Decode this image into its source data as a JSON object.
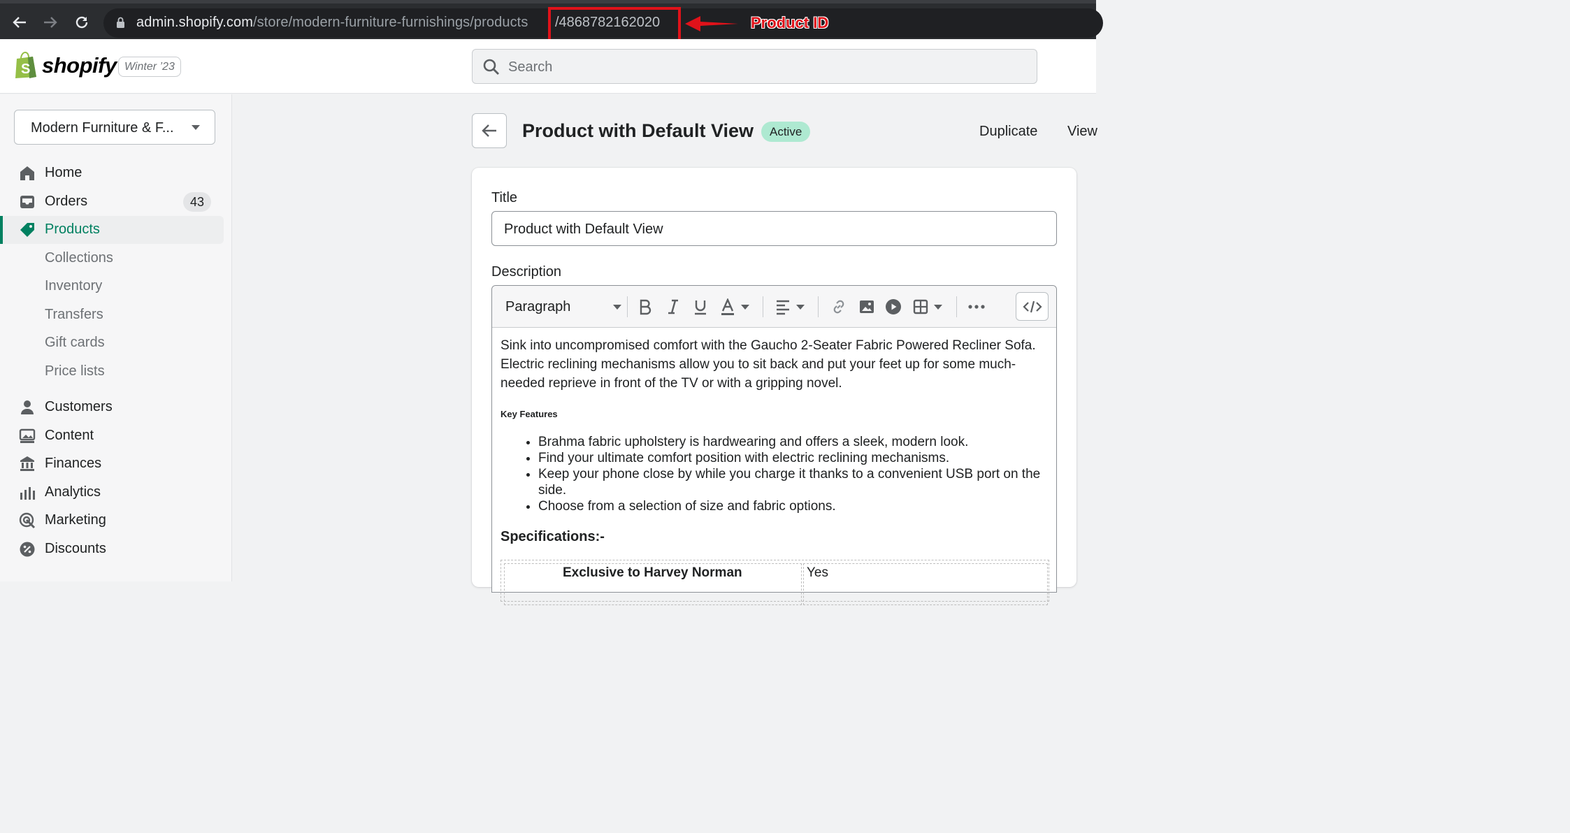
{
  "browser": {
    "url_host": "admin.shopify.com",
    "url_path": "/store/modern-furniture-furnishings/products",
    "product_id": "/4868782162020",
    "annotation_label": "Product ID"
  },
  "topbar": {
    "logo_text": "shopify",
    "edition_badge": "Winter ’23",
    "search_placeholder": "Search"
  },
  "sidebar": {
    "store_name": "Modern Furniture & F...",
    "items": [
      {
        "label": "Home",
        "icon": "home-icon"
      },
      {
        "label": "Orders",
        "icon": "inbox-icon",
        "badge": "43"
      },
      {
        "label": "Products",
        "icon": "tag-icon",
        "active": true
      },
      {
        "label": "Collections",
        "sub": true
      },
      {
        "label": "Inventory",
        "sub": true
      },
      {
        "label": "Transfers",
        "sub": true
      },
      {
        "label": "Gift cards",
        "sub": true
      },
      {
        "label": "Price lists",
        "sub": true
      },
      {
        "label": "Customers",
        "icon": "person-icon"
      },
      {
        "label": "Content",
        "icon": "image-icon"
      },
      {
        "label": "Finances",
        "icon": "bank-icon"
      },
      {
        "label": "Analytics",
        "icon": "bar-chart-icon"
      },
      {
        "label": "Marketing",
        "icon": "target-icon"
      },
      {
        "label": "Discounts",
        "icon": "discount-icon"
      }
    ]
  },
  "page": {
    "title": "Product with Default View",
    "status": "Active",
    "actions": [
      "Duplicate",
      "View"
    ]
  },
  "form": {
    "title_label": "Title",
    "title_value": "Product with Default View",
    "description_label": "Description",
    "paragraph_select": "Paragraph",
    "description_intro": "Sink into uncompromised comfort with the Gaucho 2-Seater Fabric Powered Recliner Sofa. Electric reclining mechanisms allow you to sit back and put your feet up for some much-needed reprieve in front of the TV or with a gripping novel.",
    "key_features_heading": "Key Features",
    "features": [
      "Brahma fabric upholstery is hardwearing and offers a sleek, modern look.",
      "Find your ultimate comfort position with electric reclining mechanisms.",
      "Keep your phone close by while you charge it thanks to a convenient USB port on the side.",
      "Choose from a selection of size and fabric options."
    ],
    "specs_heading": "Specifications:-",
    "spec_key": "Exclusive to Harvey Norman",
    "spec_value": "Yes"
  },
  "colors": {
    "accent_green": "#008060",
    "annotation_red": "#e0121a",
    "status_bg": "#aee9d1"
  }
}
